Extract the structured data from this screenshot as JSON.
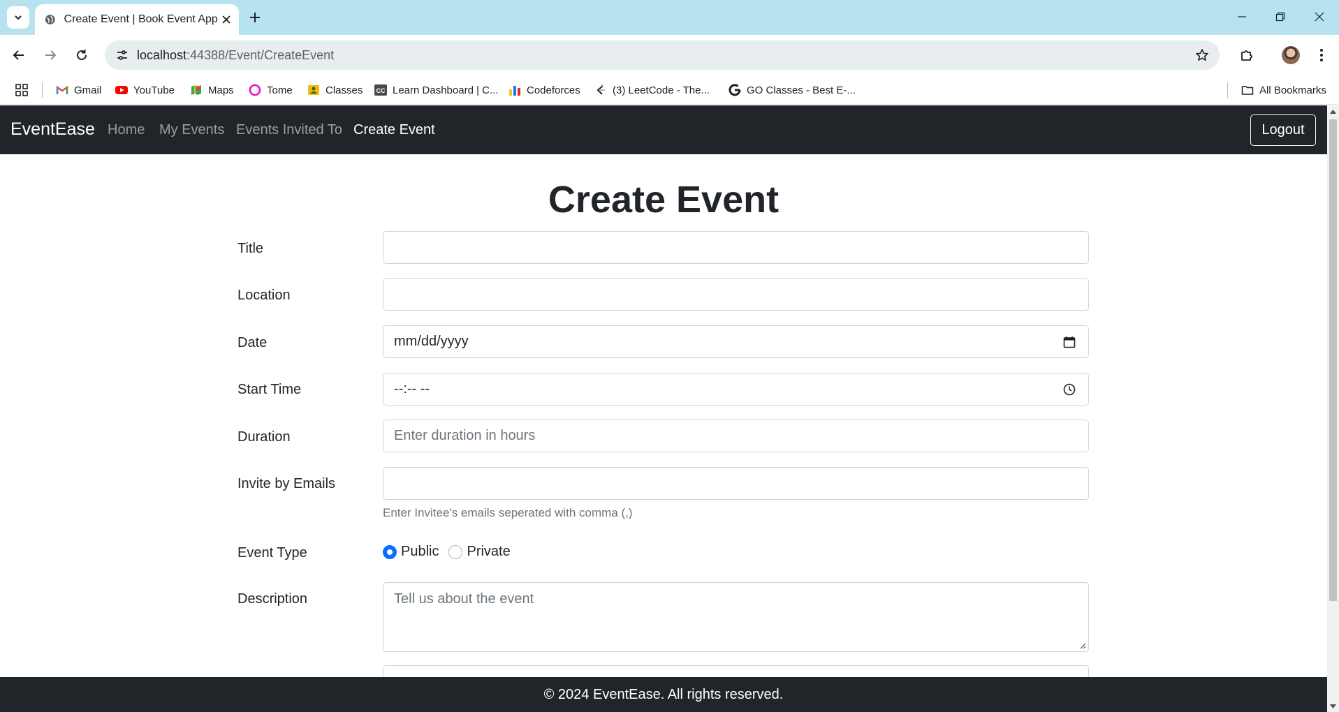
{
  "browser": {
    "tab_title": "Create Event | Book Event App",
    "url_host": "localhost",
    "url_path": ":44388/Event/CreateEvent",
    "bookmarks": [
      {
        "label": "Gmail",
        "icon": "gmail-icon"
      },
      {
        "label": "YouTube",
        "icon": "youtube-icon"
      },
      {
        "label": "Maps",
        "icon": "maps-icon"
      },
      {
        "label": "Tome",
        "icon": "tome-icon"
      },
      {
        "label": "Classes",
        "icon": "classes-icon"
      },
      {
        "label": "Learn Dashboard | C...",
        "icon": "learn-icon"
      },
      {
        "label": "Codeforces",
        "icon": "codeforces-icon"
      },
      {
        "label": "(3) LeetCode - The...",
        "icon": "leetcode-icon"
      },
      {
        "label": "GO Classes - Best E-...",
        "icon": "google-icon"
      }
    ],
    "all_bookmarks_label": "All Bookmarks"
  },
  "app": {
    "brand": "EventEase",
    "nav": [
      "Home",
      "My Events",
      "Events Invited To",
      "Create Event"
    ],
    "active_nav": "Create Event",
    "logout_label": "Logout"
  },
  "form": {
    "title": "Create Event",
    "fields": {
      "title": {
        "label": "Title",
        "placeholder": ""
      },
      "location": {
        "label": "Location",
        "placeholder": ""
      },
      "date": {
        "label": "Date",
        "value": "mm/dd/yyyy"
      },
      "start_time": {
        "label": "Start Time",
        "value": "--:-- --"
      },
      "duration": {
        "label": "Duration",
        "placeholder": "Enter duration in hours"
      },
      "invite": {
        "label": "Invite by Emails",
        "placeholder": "",
        "help": "Enter Invitee's emails seperated with comma (,)"
      },
      "event_type": {
        "label": "Event Type",
        "options": [
          "Public",
          "Private"
        ],
        "selected": "Public"
      },
      "description": {
        "label": "Description",
        "placeholder": "Tell us about the event"
      }
    }
  },
  "footer": {
    "text": "© 2024 EventEase. All rights reserved."
  },
  "colors": {
    "tabbar": "#b6e3ef",
    "navbar": "#212529",
    "accent": "#0d6efd"
  }
}
